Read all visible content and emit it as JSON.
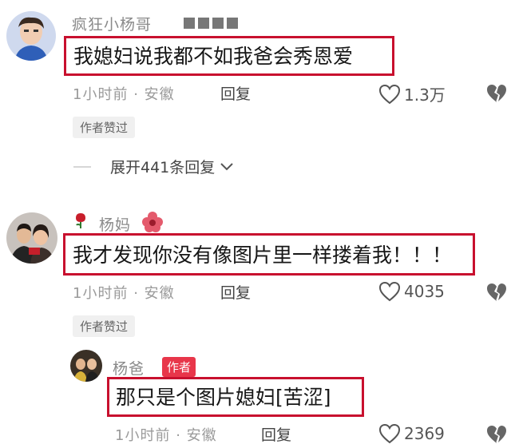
{
  "comment1": {
    "username": "疯狂小杨哥",
    "text": "我媳妇说我都不如我爸会秀恩爱",
    "time": "1小时前",
    "location": "安徽",
    "reply_label": "回复",
    "likes": "1.3万",
    "author_liked_label": "作者赞过",
    "expand_label": "展开441条回复"
  },
  "comment2": {
    "username": "杨妈",
    "text": "我才发现你没有像图片里一样搂着我！！！",
    "time": "1小时前",
    "location": "安徽",
    "reply_label": "回复",
    "likes": "4035",
    "author_liked_label": "作者赞过"
  },
  "reply1": {
    "username": "杨爸",
    "author_badge": "作者",
    "text": "那只是个图片媳妇[苦涩]",
    "time": "1小时前",
    "location": "安徽",
    "reply_label": "回复",
    "likes": "2369"
  },
  "separator": "·",
  "icons": {
    "heart": "heart-outline-icon",
    "dislike": "broken-heart-icon",
    "chevron": "chevron-down-icon"
  },
  "colors": {
    "highlight_border": "#c8102e",
    "author_badge": "#e8364a",
    "meta_text": "#9a9a9a"
  }
}
